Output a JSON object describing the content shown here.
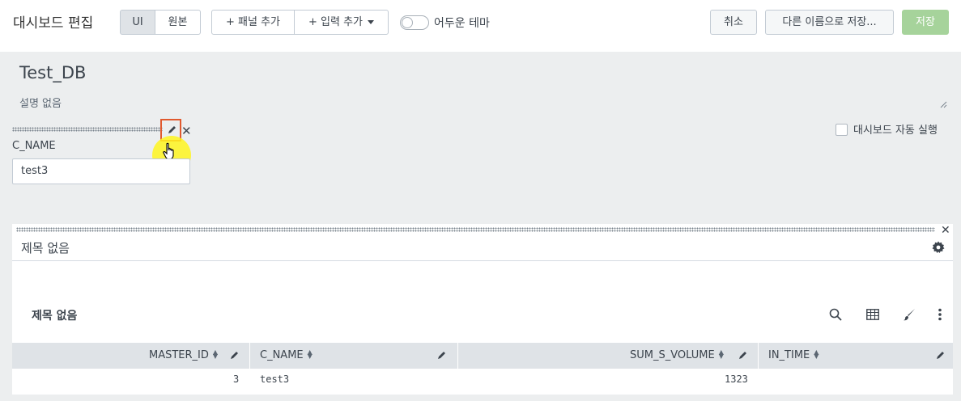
{
  "header": {
    "title": "대시보드 편집",
    "view_tabs": [
      "UI",
      "원본"
    ],
    "add_panel": "+ 패널 추가",
    "add_input": "+ 입력 추가",
    "dark_theme": "어두운 테마",
    "cancel": "취소",
    "save_as": "다른 이름으로 저장...",
    "save": "저장"
  },
  "dashboard": {
    "title": "Test_DB",
    "description": "설명 없음",
    "autorun_label": "대시보드 자동 실행"
  },
  "input": {
    "label": "C_NAME",
    "value": "test3"
  },
  "panel": {
    "title": "제목 없음",
    "viz_title": "제목 없음",
    "columns": [
      "MASTER_ID",
      "C_NAME",
      "SUM_S_VOLUME",
      "IN_TIME"
    ],
    "rows": [
      {
        "master_id": "3",
        "c_name": "test3",
        "sum_s_volume": "1323",
        "in_time": ""
      }
    ]
  },
  "colors": {
    "save_button": "#a6d39b",
    "highlight_box": "#e0592e",
    "cursor_highlight": "#fff51e"
  }
}
